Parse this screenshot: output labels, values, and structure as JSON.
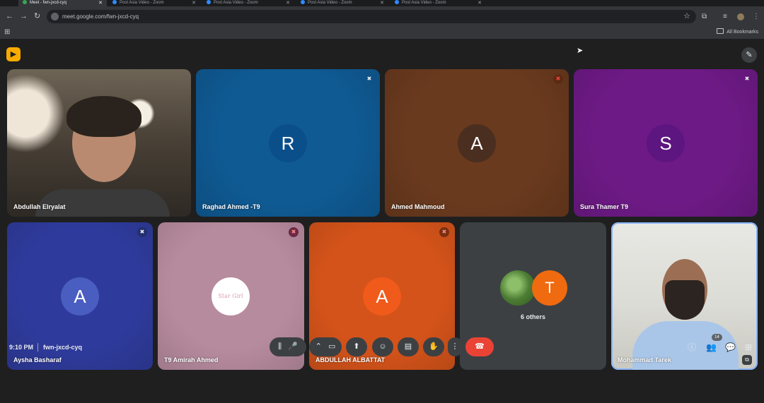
{
  "browser": {
    "tabs": [
      {
        "title": "Meet - fwn-jxcd-cyq",
        "fav": "#34a853"
      },
      {
        "title": "Post Asia Video - Zoom",
        "fav": "#2d8cff"
      },
      {
        "title": "Post Asia Video - Zoom",
        "fav": "#2d8cff"
      },
      {
        "title": "Post Asia Video - Zoom",
        "fav": "#2d8cff"
      },
      {
        "title": "Post Asia Video - Zoom",
        "fav": "#2d8cff"
      }
    ],
    "url": "meet.google.com/fwn-jxcd-cyq",
    "all_bookmarks": "All Bookmarks",
    "icons": {
      "back": "←",
      "forward": "→",
      "reload": "↻",
      "star": "☆",
      "extensions": "⧉",
      "menu": "⋮",
      "apps": "⊞"
    }
  },
  "meet": {
    "logo_icon": "meet-logo",
    "cursor": "➤",
    "effects_icon": "✎",
    "participants": [
      {
        "name": "Abdullah Elryalat",
        "type": "video"
      },
      {
        "name": "Raghad Ahmed -T9",
        "initial": "R",
        "bg": "#0f5a93",
        "avatar_bg": "#0b4f8a",
        "muted": true
      },
      {
        "name": "Ahmed Mahmoud",
        "initial": "A",
        "bg": "#6a3a1e",
        "avatar_bg": "#4a2e20",
        "muted": true
      },
      {
        "name": "Sura Thamer T9",
        "initial": "S",
        "bg": "#6e1a86",
        "avatar_bg": "#5d1580",
        "muted": true
      },
      {
        "name": "Aysha Basharaf",
        "initial": "A",
        "bg": "#2f3b9c",
        "avatar_bg": "#4a5dc0",
        "muted": true
      },
      {
        "name": "T9 Amirah Ahmed",
        "initial": "Star Girl",
        "bg": "#b78b9e",
        "avatar_bg": "#ffffff",
        "muted": true
      },
      {
        "name": "ABDULLAH ALBATTAT",
        "initial": "A",
        "bg": "#d4531a",
        "avatar_bg": "#f05a1a",
        "muted": true
      },
      {
        "name": "Mohammad Tarek",
        "type": "video",
        "pinned": true
      }
    ],
    "others": {
      "label": "6 others",
      "initial": "T"
    },
    "mute_glyph": "✖"
  },
  "bottom_bar": {
    "time": "9:10 PM",
    "meeting_code": "fwn-jxcd-cyq",
    "controls": [
      "⫼",
      "🎤",
      "⌃",
      "▭",
      "⬆",
      "☺",
      "▤",
      "✋",
      "⋮",
      "☎"
    ],
    "right_icons": [
      "ⓘ",
      "👥",
      "💬",
      "⊞"
    ],
    "participant_count": "14"
  }
}
